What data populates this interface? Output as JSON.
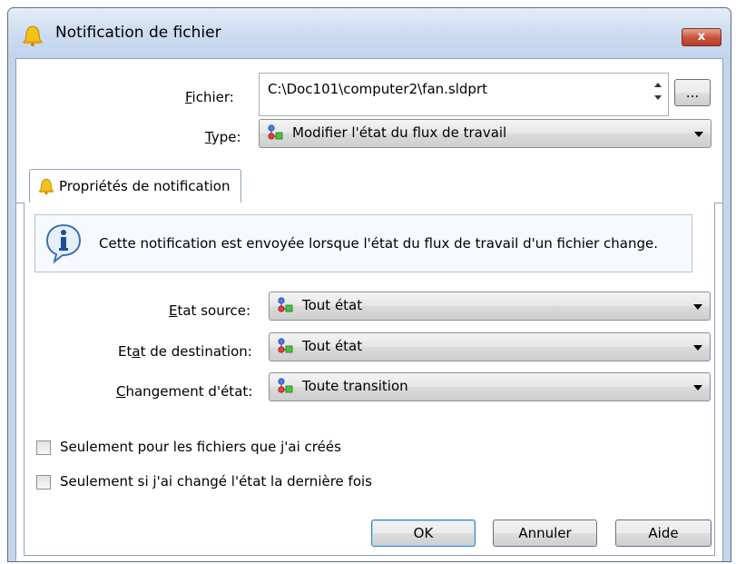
{
  "window": {
    "title": "Notification de fichier",
    "close_label": "x"
  },
  "file": {
    "label_prefix": "F",
    "label_rest": "ichier:",
    "value": "C:\\Doc101\\computer2\\fan.sldprt",
    "browse_label": "..."
  },
  "type": {
    "label_prefix": "T",
    "label_rest": "ype:",
    "value": "Modifier l'état du flux de travail"
  },
  "tab": {
    "label": "Propriétés de notification"
  },
  "info": {
    "text": "Cette notification est envoyée lorsque l'état du flux de travail d'un fichier change."
  },
  "source_state": {
    "label_prefix": "E",
    "label_rest": "tat source:",
    "value": "Tout état"
  },
  "dest_state": {
    "label_a": "Et",
    "label_u": "a",
    "label_b": "t de destination:",
    "value": "Tout état"
  },
  "state_change": {
    "label_prefix": "C",
    "label_rest": "hangement d'état:",
    "value": "Toute transition"
  },
  "options": {
    "own_files": "Seulement pour les fichiers que j'ai créés",
    "last_changed": "Seulement si j'ai changé l'état la dernière fois"
  },
  "buttons": {
    "ok": "OK",
    "cancel": "Annuler",
    "help": "Aide"
  }
}
